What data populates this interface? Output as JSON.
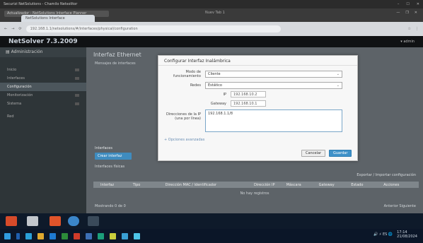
{
  "window": {
    "title": "Securizi NetSolutions - Chamilo Netsolitor",
    "controls": [
      "–",
      "☐",
      "✕"
    ]
  },
  "tabs": {
    "tab1": "Actualizador - NetSolutions Interface Planner",
    "tab2": "NetSolutions Interface",
    "strip_title": "Nuev Tab 1"
  },
  "address": {
    "url": "192.168.1.1/netsolutions/#/interfaces/physical/configuration",
    "icons": [
      "←",
      "→",
      "⟳",
      "☆",
      "⋮"
    ]
  },
  "app": {
    "title": "NetSolver 7.3.2009",
    "user": "▾ admin"
  },
  "sidebar": {
    "header": "▤ Administración",
    "items": [
      {
        "label": "Inicio"
      },
      {
        "label": "Interfaces"
      },
      {
        "label": "Configuración"
      },
      {
        "label": "Monitorización"
      },
      {
        "label": "Sistema"
      },
      {
        "label": "Red"
      }
    ]
  },
  "main": {
    "title": "Interfaz Ethernet",
    "subtitle": "Mensajes de interfaces",
    "section_label": "Interfaces",
    "create_button": "Crear interfaz",
    "section2": "Interfaces físicas",
    "export": "Exportar / Importar configuración",
    "table_headers": [
      "Interfaz",
      "Tipo",
      "Dirección MAC / Identificador",
      "Dirección IP",
      "Máscara",
      "Gateway",
      "Estado",
      "Acciones"
    ],
    "empty": "No hay registros",
    "footer": "Mostrando 0 de 0",
    "pagination": "Anterior  Siguiente"
  },
  "modal": {
    "title": "Configurar Interfaz Inalámbrica",
    "fields": {
      "mode": {
        "label": "Modo de funcionamiento",
        "value": "Cliente"
      },
      "network": {
        "label": "Redes",
        "value": "Estático"
      },
      "ip": {
        "label": "IP",
        "value": "192.168.10.2"
      },
      "gateway": {
        "label": "Gateway",
        "value": "192.168.10.1"
      },
      "address": {
        "label": "Direcciones de la IP (una por línea)",
        "value": "192.168.1.1/8"
      }
    },
    "link": "+ Opciones avanzadas",
    "cancel": "Cancelar",
    "save": "Guardar"
  },
  "taskbar": {
    "clock": "17:14\n21/08/2024",
    "tray": "🔊 ⚡ ES 🌐"
  },
  "colors": {
    "accent": "#3e91c9",
    "sidebar": "#2e3538",
    "overlay": "#5d6368"
  }
}
